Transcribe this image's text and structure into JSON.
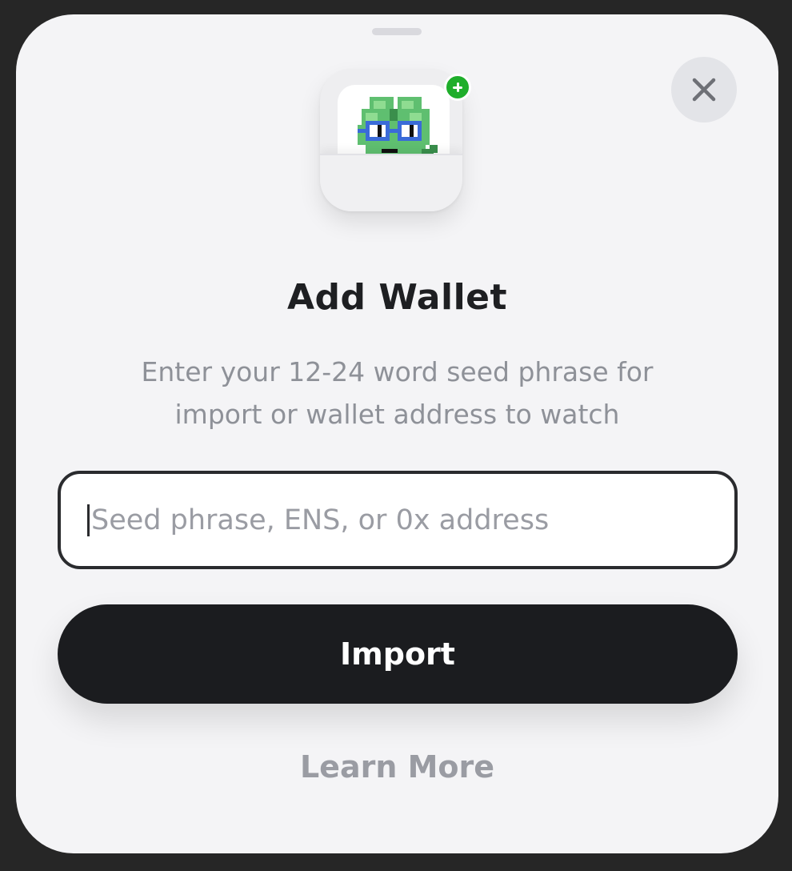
{
  "sheet": {
    "title": "Add Wallet",
    "subtitle": "Enter your 12-24 word seed phrase for import or wallet address to watch"
  },
  "input": {
    "placeholder": "Seed phrase, ENS, or 0x address",
    "value": ""
  },
  "buttons": {
    "import_label": "Import",
    "learn_more_label": "Learn More"
  },
  "icons": {
    "close": "close-icon",
    "app": "wallet-app-icon",
    "badge": "plus-badge-icon"
  },
  "colors": {
    "background": "#262626",
    "sheet": "#f4f4f6",
    "primary_button": "#1b1c1f",
    "badge_green": "#1fae2b",
    "muted_text": "#8e9198"
  }
}
